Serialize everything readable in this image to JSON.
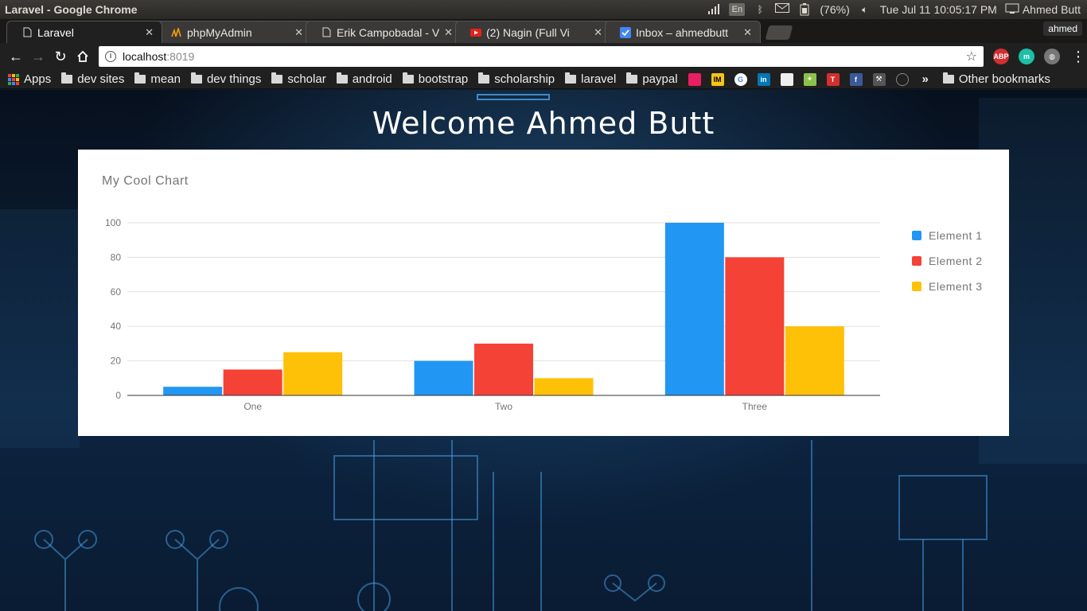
{
  "os": {
    "window_title": "Laravel - Google Chrome",
    "keyboard_layout": "En",
    "battery": "(76%)",
    "datetime": "Tue Jul 11 10:05:17 PM",
    "user": "Ahmed Butt"
  },
  "browser": {
    "profile": "ahmed",
    "tabs": [
      {
        "label": "Laravel",
        "favicon": "page-icon",
        "active": true
      },
      {
        "label": "phpMyAdmin",
        "favicon": "phpmyadmin-icon",
        "active": false
      },
      {
        "label": "Erik Campobadal - V",
        "favicon": "page-icon",
        "active": false
      },
      {
        "label": "(2) Nagin (Full Vi",
        "favicon": "youtube-icon",
        "active": false
      },
      {
        "label": "Inbox – ahmedbutt",
        "favicon": "inbox-icon",
        "active": false
      }
    ],
    "url_host": "localhost",
    "url_port": ":8019",
    "bookmarks": [
      {
        "label": "Apps",
        "icon": "apps-grid-icon"
      },
      {
        "label": "dev sites",
        "icon": "folder-icon"
      },
      {
        "label": "mean",
        "icon": "folder-icon"
      },
      {
        "label": "dev things",
        "icon": "folder-icon"
      },
      {
        "label": "scholar",
        "icon": "folder-icon"
      },
      {
        "label": "android",
        "icon": "folder-icon"
      },
      {
        "label": "bootstrap",
        "icon": "folder-icon"
      },
      {
        "label": "scholarship",
        "icon": "folder-icon"
      },
      {
        "label": "laravel",
        "icon": "folder-icon"
      },
      {
        "label": "paypal",
        "icon": "folder-icon"
      }
    ],
    "bookmark_more": "»",
    "other_bookmarks": "Other bookmarks"
  },
  "page": {
    "heading": "Welcome Ahmed Butt"
  },
  "colors": {
    "series1": "#2196f3",
    "series2": "#f44336",
    "series3": "#ffc107",
    "gridline": "#e0e0e0",
    "axis_text": "#757575"
  },
  "chart_data": {
    "type": "bar",
    "title": "My Cool Chart",
    "categories": [
      "One",
      "Two",
      "Three"
    ],
    "series": [
      {
        "name": "Element 1",
        "values": [
          5,
          20,
          100
        ]
      },
      {
        "name": "Element 2",
        "values": [
          15,
          30,
          80
        ]
      },
      {
        "name": "Element 3",
        "values": [
          25,
          10,
          40
        ]
      }
    ],
    "ylim": [
      0,
      100
    ],
    "yticks": [
      0,
      20,
      40,
      60,
      80,
      100
    ],
    "grid": true,
    "legend_position": "right"
  }
}
